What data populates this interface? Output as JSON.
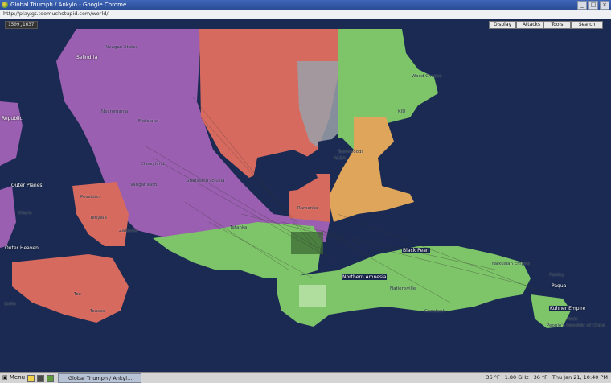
{
  "window": {
    "title": "Global Triumph / Ankylo - Google Chrome",
    "url": "http://play.gt.toomuchstupid.com/world/",
    "controls": [
      "_",
      "□",
      "×"
    ]
  },
  "toolbar": {
    "coords": "1509,1637",
    "buttons": [
      "Display",
      "Attacks",
      "Tools",
      "Search"
    ]
  },
  "map": {
    "colors": {
      "ocean": "#1a2a52",
      "purple": "#9a5fb0",
      "red": "#d76a5f",
      "green": "#7ec468",
      "orange": "#dfa55a",
      "grey": "#9aa0a8"
    },
    "labels": [
      "Selindria",
      "Rivagan States",
      "Necromania",
      "Flateland",
      "Classyland",
      "Stansland",
      "Volusia",
      "Vanganaard",
      "Ramanka",
      "Outer Planes",
      "Poseidon",
      "Utopia",
      "Tenyala",
      "Outer Heaven",
      "Zazazoa",
      "Tox",
      "Teases",
      "Ladia",
      "Republic",
      "Tatanka",
      "Wood Cheese",
      "KID",
      "Toothwoods",
      "ALGA",
      "Northern Amnesia",
      "Black Pearl",
      "Constant",
      "Kuhner Empire",
      "Paqua",
      "Paisley",
      "People's Republic of China",
      "Farkusian Empire",
      "Nationsville",
      "Reds"
    ]
  },
  "taskbar": {
    "menu_label": "Menu",
    "task_label": "Global Triumph / Ankyl...",
    "tray": [
      "36 °F",
      "1.80 GHz",
      "36 °F",
      "Thu Jan 21, 10:40 PM"
    ]
  }
}
